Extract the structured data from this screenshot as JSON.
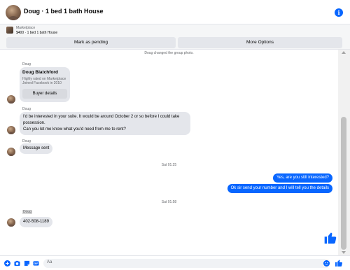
{
  "header": {
    "title": "Doug · 1 bed 1 bath House",
    "info_icon": "info-icon"
  },
  "marketplace": {
    "label": "Marketplace",
    "listing": "$400 · 1 bed 1 bath House",
    "mark_pending_label": "Mark as pending",
    "more_options_label": "More Options"
  },
  "chat": {
    "system_message": "Doug changed the group photo.",
    "card": {
      "sender": "Doug",
      "name": "Doug Blatchford",
      "line1": "Highly rated on Marketplace",
      "line2": "Joined Facebook in 2010",
      "button_label": "Buyer details"
    },
    "msg1": {
      "sender": "Doug",
      "line1": "I'd be interested in your suite. It would be around October 2 or so before I could take",
      "line2": "possession.",
      "line3": "Can you let me know what you'd need from me to rent?"
    },
    "msg2": {
      "sender": "Doug",
      "text": "Message sent"
    },
    "time1": "Sat 01:25",
    "out1": "Yes, are you still interested?",
    "out2": "Ok sir send your number and I will tell you the details",
    "time2": "Sat 01:58",
    "msg3": {
      "sender": "Doug",
      "text": "402-508-1189"
    }
  },
  "composer": {
    "placeholder": "Aa"
  },
  "colors": {
    "accent": "#0866ff",
    "incoming_bubble": "#e4e6eb"
  }
}
